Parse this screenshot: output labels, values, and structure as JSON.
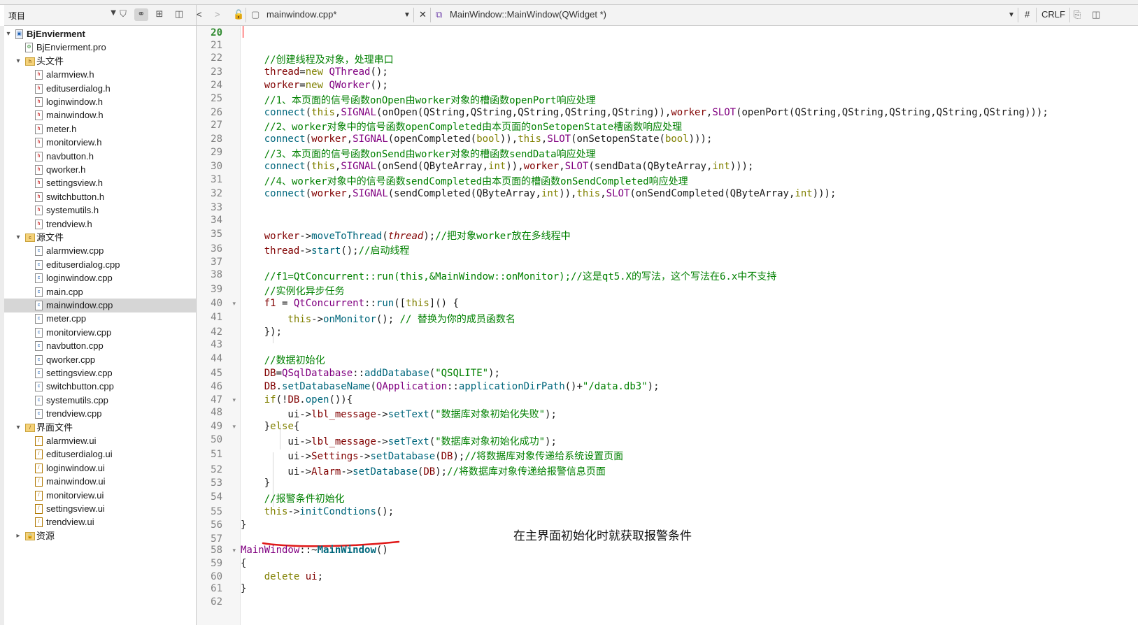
{
  "sidebar": {
    "view_combo": "项目",
    "tree": [
      {
        "label": "BjEnvierment",
        "kind": "project",
        "depth": 0,
        "expander": "▾",
        "bold": true
      },
      {
        "label": "BjEnvierment.pro",
        "kind": "pro",
        "depth": 1,
        "expander": ""
      },
      {
        "label": "头文件",
        "kind": "folder-h",
        "depth": 1,
        "expander": "▾"
      },
      {
        "label": "alarmview.h",
        "kind": "h",
        "depth": 2,
        "expander": ""
      },
      {
        "label": "edituserdialog.h",
        "kind": "h",
        "depth": 2,
        "expander": ""
      },
      {
        "label": "loginwindow.h",
        "kind": "h",
        "depth": 2,
        "expander": ""
      },
      {
        "label": "mainwindow.h",
        "kind": "h",
        "depth": 2,
        "expander": ""
      },
      {
        "label": "meter.h",
        "kind": "h",
        "depth": 2,
        "expander": ""
      },
      {
        "label": "monitorview.h",
        "kind": "h",
        "depth": 2,
        "expander": ""
      },
      {
        "label": "navbutton.h",
        "kind": "h",
        "depth": 2,
        "expander": ""
      },
      {
        "label": "qworker.h",
        "kind": "h",
        "depth": 2,
        "expander": ""
      },
      {
        "label": "settingsview.h",
        "kind": "h",
        "depth": 2,
        "expander": ""
      },
      {
        "label": "switchbutton.h",
        "kind": "h",
        "depth": 2,
        "expander": ""
      },
      {
        "label": "systemutils.h",
        "kind": "h",
        "depth": 2,
        "expander": ""
      },
      {
        "label": "trendview.h",
        "kind": "h",
        "depth": 2,
        "expander": ""
      },
      {
        "label": "源文件",
        "kind": "folder-cpp",
        "depth": 1,
        "expander": "▾"
      },
      {
        "label": "alarmview.cpp",
        "kind": "cpp",
        "depth": 2,
        "expander": ""
      },
      {
        "label": "edituserdialog.cpp",
        "kind": "cpp",
        "depth": 2,
        "expander": ""
      },
      {
        "label": "loginwindow.cpp",
        "kind": "cpp",
        "depth": 2,
        "expander": ""
      },
      {
        "label": "main.cpp",
        "kind": "cpp",
        "depth": 2,
        "expander": ""
      },
      {
        "label": "mainwindow.cpp",
        "kind": "cpp",
        "depth": 2,
        "expander": "",
        "selected": true
      },
      {
        "label": "meter.cpp",
        "kind": "cpp",
        "depth": 2,
        "expander": ""
      },
      {
        "label": "monitorview.cpp",
        "kind": "cpp",
        "depth": 2,
        "expander": ""
      },
      {
        "label": "navbutton.cpp",
        "kind": "cpp",
        "depth": 2,
        "expander": ""
      },
      {
        "label": "qworker.cpp",
        "kind": "cpp",
        "depth": 2,
        "expander": ""
      },
      {
        "label": "settingsview.cpp",
        "kind": "cpp",
        "depth": 2,
        "expander": ""
      },
      {
        "label": "switchbutton.cpp",
        "kind": "cpp",
        "depth": 2,
        "expander": ""
      },
      {
        "label": "systemutils.cpp",
        "kind": "cpp",
        "depth": 2,
        "expander": ""
      },
      {
        "label": "trendview.cpp",
        "kind": "cpp",
        "depth": 2,
        "expander": ""
      },
      {
        "label": "界面文件",
        "kind": "folder-ui",
        "depth": 1,
        "expander": "▾"
      },
      {
        "label": "alarmview.ui",
        "kind": "ui",
        "depth": 2,
        "expander": ""
      },
      {
        "label": "edituserdialog.ui",
        "kind": "ui",
        "depth": 2,
        "expander": ""
      },
      {
        "label": "loginwindow.ui",
        "kind": "ui",
        "depth": 2,
        "expander": ""
      },
      {
        "label": "mainwindow.ui",
        "kind": "ui",
        "depth": 2,
        "expander": ""
      },
      {
        "label": "monitorview.ui",
        "kind": "ui",
        "depth": 2,
        "expander": ""
      },
      {
        "label": "settingsview.ui",
        "kind": "ui",
        "depth": 2,
        "expander": ""
      },
      {
        "label": "trendview.ui",
        "kind": "ui",
        "depth": 2,
        "expander": ""
      },
      {
        "label": "资源",
        "kind": "folder-res",
        "depth": 1,
        "expander": "▸"
      }
    ]
  },
  "editor_toolbar": {
    "file_combo": "mainwindow.cpp*",
    "symbol_combo": "MainWindow::MainWindow(QWidget *)",
    "hash": "#",
    "line_ending": "CRLF"
  },
  "editor": {
    "current_line": "20",
    "lines": [
      {
        "n": "20",
        "f": "",
        "h": [
          [
            "",
            ""
          ]
        ]
      },
      {
        "n": "21",
        "f": "",
        "h": [
          [
            "",
            ""
          ]
        ]
      },
      {
        "n": "22",
        "f": "",
        "h": [
          [
            "cm",
            "    //创建线程及对象，处理串口"
          ]
        ]
      },
      {
        "n": "23",
        "f": "",
        "h": [
          [
            "vr",
            "    thread"
          ],
          [
            "",
            "="
          ],
          [
            "kw",
            "new"
          ],
          [
            "",
            ""
          ],
          [
            "cls",
            " QThread"
          ],
          [
            "",
            "();"
          ]
        ]
      },
      {
        "n": "24",
        "f": "",
        "h": [
          [
            "vr",
            "    worker"
          ],
          [
            "",
            "="
          ],
          [
            "kw",
            "new"
          ],
          [
            "cls",
            " QWorker"
          ],
          [
            "",
            "();"
          ]
        ]
      },
      {
        "n": "25",
        "f": "",
        "h": [
          [
            "cm",
            "    //1、本页面的信号函数onOpen由worker对象的槽函数openPort响应处理"
          ]
        ]
      },
      {
        "n": "26",
        "f": "",
        "h": [
          [
            "fn",
            "    connect"
          ],
          [
            "",
            "("
          ],
          [
            "kw",
            "this"
          ],
          [
            "",
            ","
          ],
          [
            "mc",
            "SIGNAL"
          ],
          [
            "",
            "(onOpen(QString,QString,QString,QString,QString)),"
          ],
          [
            "vr",
            "worker"
          ],
          [
            "",
            ","
          ],
          [
            "mc",
            "SLOT"
          ],
          [
            "",
            "(openPort(QString,QString,QString,QString,QString)));"
          ]
        ]
      },
      {
        "n": "27",
        "f": "",
        "h": [
          [
            "cm",
            "    //2、worker对象中的信号函数openCompleted由本页面的onSetopenState槽函数响应处理"
          ]
        ]
      },
      {
        "n": "28",
        "f": "",
        "h": [
          [
            "fn",
            "    connect"
          ],
          [
            "",
            "("
          ],
          [
            "vr",
            "worker"
          ],
          [
            "",
            ","
          ],
          [
            "mc",
            "SIGNAL"
          ],
          [
            "",
            "(openCompleted("
          ],
          [
            "kw",
            "bool"
          ],
          [
            "",
            ")),"
          ],
          [
            "kw",
            "this"
          ],
          [
            "",
            ","
          ],
          [
            "mc",
            "SLOT"
          ],
          [
            "",
            "(onSetopenState("
          ],
          [
            "kw",
            "bool"
          ],
          [
            "",
            ")));"
          ]
        ]
      },
      {
        "n": "29",
        "f": "",
        "h": [
          [
            "cm",
            "    //3、本页面的信号函数onSend由worker对象的槽函数sendData响应处理"
          ]
        ]
      },
      {
        "n": "30",
        "f": "",
        "h": [
          [
            "fn",
            "    connect"
          ],
          [
            "",
            "("
          ],
          [
            "kw",
            "this"
          ],
          [
            "",
            ","
          ],
          [
            "mc",
            "SIGNAL"
          ],
          [
            "",
            "(onSend(QByteArray,"
          ],
          [
            "kw",
            "int"
          ],
          [
            "",
            ")),"
          ],
          [
            "vr",
            "worker"
          ],
          [
            "",
            ","
          ],
          [
            "mc",
            "SLOT"
          ],
          [
            "",
            "(sendData(QByteArray,"
          ],
          [
            "kw",
            "int"
          ],
          [
            "",
            ")));"
          ]
        ]
      },
      {
        "n": "31",
        "f": "",
        "h": [
          [
            "cm",
            "    //4、worker对象中的信号函数sendCompleted由本页面的槽函数onSendCompleted响应处理"
          ]
        ]
      },
      {
        "n": "32",
        "f": "",
        "h": [
          [
            "fn",
            "    connect"
          ],
          [
            "",
            "("
          ],
          [
            "vr",
            "worker"
          ],
          [
            "",
            ","
          ],
          [
            "mc",
            "SIGNAL"
          ],
          [
            "",
            "(sendCompleted(QByteArray,"
          ],
          [
            "kw",
            "int"
          ],
          [
            "",
            ")),"
          ],
          [
            "kw",
            "this"
          ],
          [
            "",
            ","
          ],
          [
            "mc",
            "SLOT"
          ],
          [
            "",
            "(onSendCompleted(QByteArray,"
          ],
          [
            "kw",
            "int"
          ],
          [
            "",
            ")));"
          ]
        ]
      },
      {
        "n": "33",
        "f": "",
        "h": [
          [
            "",
            ""
          ]
        ]
      },
      {
        "n": "34",
        "f": "",
        "h": [
          [
            "",
            ""
          ]
        ]
      },
      {
        "n": "35",
        "f": "",
        "h": [
          [
            "vr",
            "    worker"
          ],
          [
            "",
            "->"
          ],
          [
            "fn",
            "moveToThread"
          ],
          [
            "",
            "("
          ],
          [
            "it",
            "thread"
          ],
          [
            "",
            ");"
          ],
          [
            "cm",
            "//把对象worker放在多线程中"
          ]
        ]
      },
      {
        "n": "36",
        "f": "",
        "h": [
          [
            "vr",
            "    thread"
          ],
          [
            "",
            "->"
          ],
          [
            "fn",
            "start"
          ],
          [
            "",
            "();"
          ],
          [
            "cm",
            "//启动线程"
          ]
        ]
      },
      {
        "n": "37",
        "f": "",
        "h": [
          [
            "",
            ""
          ]
        ]
      },
      {
        "n": "38",
        "f": "",
        "h": [
          [
            "cm",
            "    //f1=QtConcurrent::run(this,&MainWindow::onMonitor);//这是qt5.X的写法，这个写法在6.x中不支持"
          ]
        ]
      },
      {
        "n": "39",
        "f": "",
        "h": [
          [
            "cm",
            "    //实例化异步任务"
          ]
        ]
      },
      {
        "n": "40",
        "f": "▾",
        "h": [
          [
            "vr",
            "    f1"
          ],
          [
            "",
            " = "
          ],
          [
            "cls",
            "QtConcurrent"
          ],
          [
            "",
            "::"
          ],
          [
            "fn",
            "run"
          ],
          [
            "",
            "(["
          ],
          [
            "kw",
            "this"
          ],
          [
            "",
            "]() {"
          ]
        ]
      },
      {
        "n": "41",
        "f": "",
        "h": [
          [
            "kw",
            "        this"
          ],
          [
            "",
            "->"
          ],
          [
            "fn",
            "onMonitor"
          ],
          [
            "",
            "(); "
          ],
          [
            "cm",
            "// 替换为你的成员函数名"
          ]
        ]
      },
      {
        "n": "42",
        "f": "",
        "h": [
          [
            "",
            "    });"
          ]
        ]
      },
      {
        "n": "43",
        "f": "",
        "h": [
          [
            "",
            ""
          ]
        ]
      },
      {
        "n": "44",
        "f": "",
        "h": [
          [
            "cm",
            "    //数据初始化"
          ]
        ]
      },
      {
        "n": "45",
        "f": "",
        "h": [
          [
            "vr",
            "    DB"
          ],
          [
            "",
            "="
          ],
          [
            "cls",
            "QSqlDatabase"
          ],
          [
            "",
            "::"
          ],
          [
            "fn",
            "addDatabase"
          ],
          [
            "",
            "("
          ],
          [
            "st",
            "\"QSQLITE\""
          ],
          [
            "",
            ");"
          ]
        ]
      },
      {
        "n": "46",
        "f": "",
        "h": [
          [
            "vr",
            "    DB"
          ],
          [
            "",
            "."
          ],
          [
            "fn",
            "setDatabaseName"
          ],
          [
            "",
            "("
          ],
          [
            "cls",
            "QApplication"
          ],
          [
            "",
            "::"
          ],
          [
            "fn",
            "applicationDirPath"
          ],
          [
            "",
            "()+"
          ],
          [
            "st",
            "\"/data.db3\""
          ],
          [
            "",
            ");"
          ]
        ]
      },
      {
        "n": "47",
        "f": "▾",
        "h": [
          [
            "kw",
            "    if"
          ],
          [
            "",
            "(!"
          ],
          [
            "vr",
            "DB"
          ],
          [
            "",
            "."
          ],
          [
            "fn",
            "open"
          ],
          [
            "",
            "()){"
          ]
        ]
      },
      {
        "n": "48",
        "f": "",
        "h": [
          [
            "",
            "        ui->"
          ],
          [
            "vr",
            "lbl_message"
          ],
          [
            "",
            "->"
          ],
          [
            "fn",
            "setText"
          ],
          [
            "",
            "("
          ],
          [
            "st",
            "\"数据库对象初始化失败\""
          ],
          [
            "",
            ");"
          ]
        ]
      },
      {
        "n": "49",
        "f": "▾",
        "h": [
          [
            "",
            "    }"
          ],
          [
            "kw",
            "else"
          ],
          [
            "",
            "{"
          ]
        ]
      },
      {
        "n": "50",
        "f": "",
        "h": [
          [
            "",
            "        ui->"
          ],
          [
            "vr",
            "lbl_message"
          ],
          [
            "",
            "->"
          ],
          [
            "fn",
            "setText"
          ],
          [
            "",
            "("
          ],
          [
            "st",
            "\"数据库对象初始化成功\""
          ],
          [
            "",
            ");"
          ]
        ]
      },
      {
        "n": "51",
        "f": "",
        "h": [
          [
            "",
            "        ui->"
          ],
          [
            "vr",
            "Settings"
          ],
          [
            "",
            "->"
          ],
          [
            "fn",
            "setDatabase"
          ],
          [
            "",
            "("
          ],
          [
            "vr",
            "DB"
          ],
          [
            "",
            ");"
          ],
          [
            "cm",
            "//将数据库对象传递给系统设置页面"
          ]
        ]
      },
      {
        "n": "52",
        "f": "",
        "h": [
          [
            "",
            "        ui->"
          ],
          [
            "vr",
            "Alarm"
          ],
          [
            "",
            "->"
          ],
          [
            "fn",
            "setDatabase"
          ],
          [
            "",
            "("
          ],
          [
            "vr",
            "DB"
          ],
          [
            "",
            ");"
          ],
          [
            "cm",
            "//将数据库对象传递给报警信息页面"
          ]
        ]
      },
      {
        "n": "53",
        "f": "",
        "h": [
          [
            "",
            "    }"
          ]
        ]
      },
      {
        "n": "54",
        "f": "",
        "h": [
          [
            "cm",
            "    //报警条件初始化"
          ]
        ]
      },
      {
        "n": "55",
        "f": "",
        "h": [
          [
            "kw",
            "    this"
          ],
          [
            "",
            "->"
          ],
          [
            "fn",
            "initCondtions"
          ],
          [
            "",
            "();"
          ]
        ]
      },
      {
        "n": "56",
        "f": "",
        "h": [
          [
            "",
            "}"
          ]
        ]
      },
      {
        "n": "57",
        "f": "",
        "h": [
          [
            "",
            ""
          ]
        ]
      },
      {
        "n": "58",
        "f": "▾",
        "h": [
          [
            "cls",
            "MainWindow"
          ],
          [
            "",
            "::~"
          ],
          [
            "bfn",
            "MainWindow"
          ],
          [
            "",
            "()"
          ]
        ]
      },
      {
        "n": "59",
        "f": "",
        "h": [
          [
            "",
            "{"
          ]
        ]
      },
      {
        "n": "60",
        "f": "",
        "h": [
          [
            "kw",
            "    delete"
          ],
          [
            "",
            " "
          ],
          [
            "vr",
            "ui"
          ],
          [
            "",
            ";"
          ]
        ]
      },
      {
        "n": "61",
        "f": "",
        "h": [
          [
            "",
            "}"
          ]
        ]
      },
      {
        "n": "62",
        "f": "",
        "h": [
          [
            "",
            ""
          ]
        ]
      }
    ],
    "annotation": "在主界面初始化时就获取报警条件"
  },
  "colors": {
    "keyword": "#808000",
    "comment": "#008000",
    "annotation_underline": "#e01818"
  }
}
